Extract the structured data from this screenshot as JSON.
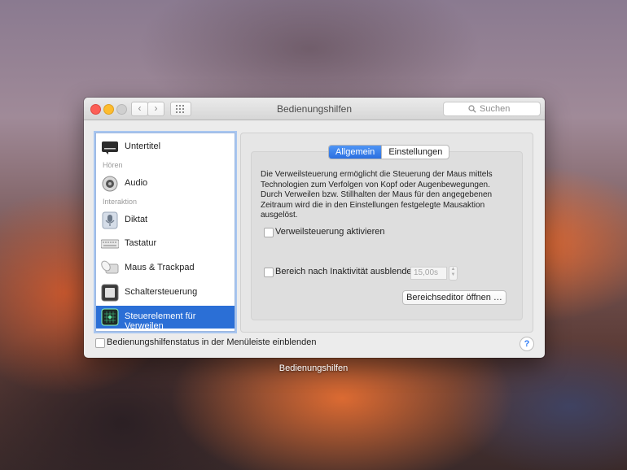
{
  "window": {
    "title": "Bedienungshilfen",
    "search_placeholder": "Suchen"
  },
  "sidebar": {
    "items": [
      {
        "label": "Untertitel",
        "icon": "subtitles-icon"
      },
      {
        "label": "Audio",
        "icon": "speaker-icon"
      },
      {
        "label": "Diktat",
        "icon": "microphone-icon"
      },
      {
        "label": "Tastatur",
        "icon": "keyboard-icon"
      },
      {
        "label": "Maus & Trackpad",
        "icon": "mouse-icon"
      },
      {
        "label": "Schaltersteuerung",
        "icon": "switch-control-icon"
      },
      {
        "label": "Steuerelement für Verweilen",
        "icon": "dwell-control-icon",
        "selected": true
      }
    ],
    "section_hoeren": "Hören",
    "section_interaktion": "Interaktion"
  },
  "tabs": [
    "Allgemein",
    "Einstellungen"
  ],
  "description": "Die Verweilsteuerung ermöglicht die Steuerung der Maus mittels Technologien zum Verfolgen von Kopf oder Augenbewegungen. Durch Verweilen bzw. Stillhalten der Maus für den angegebenen Zeitraum wird die in den Einstellungen festgelegte Mausaktion ausgelöst.",
  "options": {
    "enable_label": "Verweilsteuerung aktivieren",
    "hide_label": "Bereich nach Inaktivität ausblenden",
    "hide_value": "15,00s",
    "editor_button": "Bereichseditor öffnen …"
  },
  "footer": {
    "menubar_label": "Bedienungshilfenstatus in der Menüleiste einblenden",
    "help": "?"
  },
  "caption": "Bedienungshilfen",
  "colors": {
    "accent": "#2b6fd6"
  }
}
